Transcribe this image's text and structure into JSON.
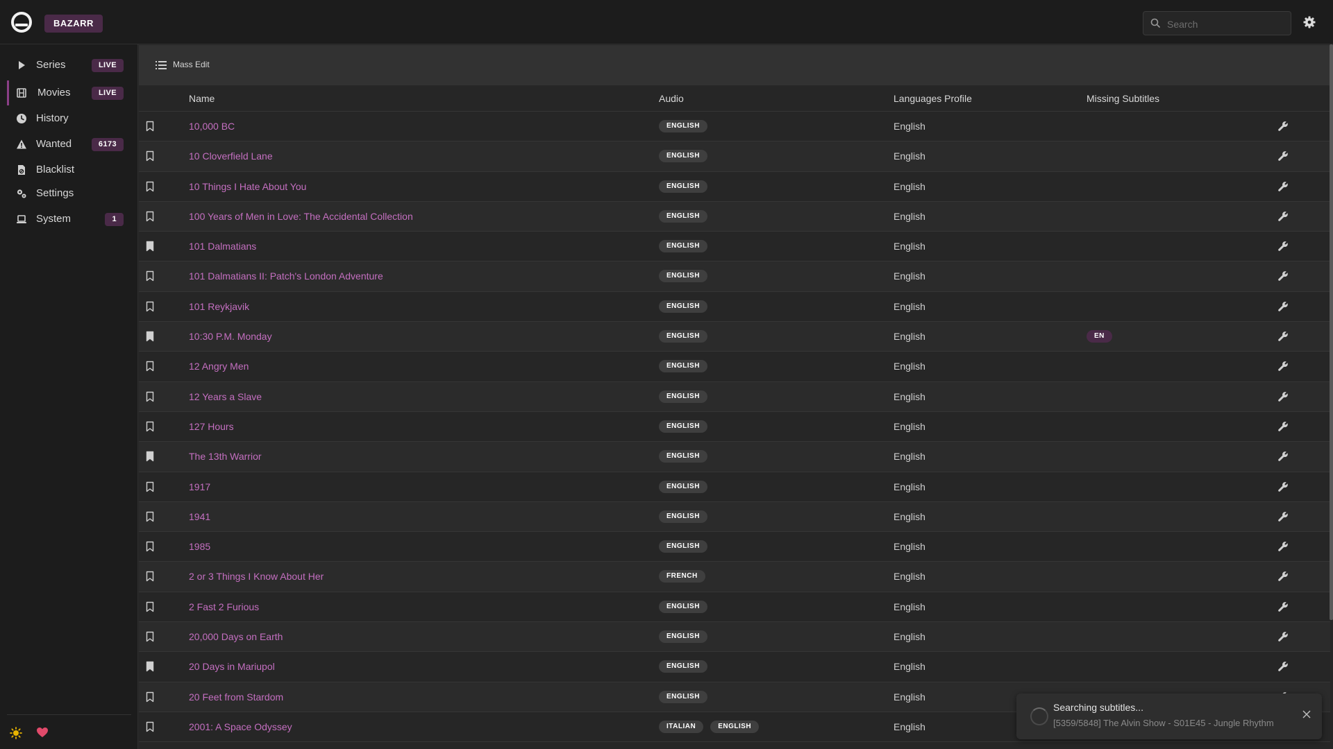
{
  "app": {
    "title": "BAZARR"
  },
  "search": {
    "placeholder": "Search",
    "value": ""
  },
  "sidebar": {
    "items": [
      {
        "label": "Series",
        "badge": "LIVE",
        "icon": "play-icon",
        "active": false
      },
      {
        "label": "Movies",
        "badge": "LIVE",
        "icon": "film-icon",
        "active": true
      },
      {
        "label": "History",
        "badge": "",
        "icon": "clock-icon",
        "active": false
      },
      {
        "label": "Wanted",
        "badge": "6173",
        "icon": "warning-icon",
        "active": false
      },
      {
        "label": "Blacklist",
        "badge": "",
        "icon": "file-ban-icon",
        "active": false
      },
      {
        "label": "Settings",
        "badge": "",
        "icon": "cogs-icon",
        "active": false
      },
      {
        "label": "System",
        "badge": "1",
        "icon": "laptop-icon",
        "active": false
      }
    ],
    "footer_icons": [
      "sun-icon",
      "heart-icon"
    ]
  },
  "toolbar": {
    "mass_edit_label": "Mass Edit"
  },
  "table": {
    "columns": [
      "Name",
      "Audio",
      "Languages Profile",
      "Missing Subtitles"
    ],
    "rows": [
      {
        "name": "10,000 BC",
        "audio": [
          "ENGLISH"
        ],
        "profile": "English",
        "missing": [],
        "monitored": false
      },
      {
        "name": "10 Cloverfield Lane",
        "audio": [
          "ENGLISH"
        ],
        "profile": "English",
        "missing": [],
        "monitored": false
      },
      {
        "name": "10 Things I Hate About You",
        "audio": [
          "ENGLISH"
        ],
        "profile": "English",
        "missing": [],
        "monitored": false
      },
      {
        "name": "100 Years of Men in Love: The Accidental Collection",
        "audio": [
          "ENGLISH"
        ],
        "profile": "English",
        "missing": [],
        "monitored": false
      },
      {
        "name": "101 Dalmatians",
        "audio": [
          "ENGLISH"
        ],
        "profile": "English",
        "missing": [],
        "monitored": true
      },
      {
        "name": "101 Dalmatians II: Patch's London Adventure",
        "audio": [
          "ENGLISH"
        ],
        "profile": "English",
        "missing": [],
        "monitored": false
      },
      {
        "name": "101 Reykjavik",
        "audio": [
          "ENGLISH"
        ],
        "profile": "English",
        "missing": [],
        "monitored": false
      },
      {
        "name": "10:30 P.M. Monday",
        "audio": [
          "ENGLISH"
        ],
        "profile": "English",
        "missing": [
          "EN"
        ],
        "monitored": true
      },
      {
        "name": "12 Angry Men",
        "audio": [
          "ENGLISH"
        ],
        "profile": "English",
        "missing": [],
        "monitored": false
      },
      {
        "name": "12 Years a Slave",
        "audio": [
          "ENGLISH"
        ],
        "profile": "English",
        "missing": [],
        "monitored": false
      },
      {
        "name": "127 Hours",
        "audio": [
          "ENGLISH"
        ],
        "profile": "English",
        "missing": [],
        "monitored": false
      },
      {
        "name": "The 13th Warrior",
        "audio": [
          "ENGLISH"
        ],
        "profile": "English",
        "missing": [],
        "monitored": true
      },
      {
        "name": "1917",
        "audio": [
          "ENGLISH"
        ],
        "profile": "English",
        "missing": [],
        "monitored": false
      },
      {
        "name": "1941",
        "audio": [
          "ENGLISH"
        ],
        "profile": "English",
        "missing": [],
        "monitored": false
      },
      {
        "name": "1985",
        "audio": [
          "ENGLISH"
        ],
        "profile": "English",
        "missing": [],
        "monitored": false
      },
      {
        "name": "2 or 3 Things I Know About Her",
        "audio": [
          "FRENCH"
        ],
        "profile": "English",
        "missing": [],
        "monitored": false
      },
      {
        "name": "2 Fast 2 Furious",
        "audio": [
          "ENGLISH"
        ],
        "profile": "English",
        "missing": [],
        "monitored": false
      },
      {
        "name": "20,000 Days on Earth",
        "audio": [
          "ENGLISH"
        ],
        "profile": "English",
        "missing": [],
        "monitored": false
      },
      {
        "name": "20 Days in Mariupol",
        "audio": [
          "ENGLISH"
        ],
        "profile": "English",
        "missing": [],
        "monitored": true
      },
      {
        "name": "20 Feet from Stardom",
        "audio": [
          "ENGLISH"
        ],
        "profile": "English",
        "missing": [],
        "monitored": false
      },
      {
        "name": "2001: A Space Odyssey",
        "audio": [
          "ITALIAN",
          "ENGLISH"
        ],
        "profile": "English",
        "missing": [],
        "monitored": false
      }
    ]
  },
  "toast": {
    "title": "Searching subtitles...",
    "message": "[5359/5848] The Alvin Show - S01E45 - Jungle Rhythm"
  },
  "colors": {
    "accent": "#c46fc0",
    "badge_bg": "#4a2a48",
    "chip_bg": "#3f3f3f",
    "background": "#262626",
    "sidebar_bg": "#1c1c1c"
  }
}
